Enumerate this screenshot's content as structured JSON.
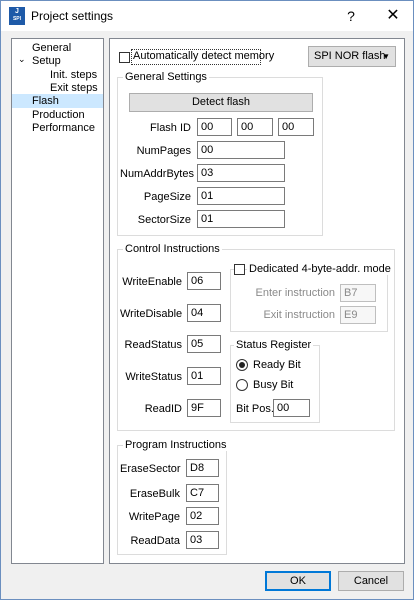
{
  "window": {
    "title": "Project settings",
    "app_icon_text_top": "J",
    "app_icon_text_bottom": "SPI",
    "help_label": "?",
    "close_label": "✕"
  },
  "nav": {
    "items": [
      {
        "label": "General",
        "selected": false
      },
      {
        "label": "Setup",
        "selected": false,
        "expanded": true
      },
      {
        "label": "Init. steps",
        "selected": false
      },
      {
        "label": "Exit steps",
        "selected": false
      },
      {
        "label": "Flash",
        "selected": true
      },
      {
        "label": "Production",
        "selected": false
      },
      {
        "label": "Performance",
        "selected": false
      }
    ],
    "expander_glyph": "⌄"
  },
  "flash": {
    "auto_detect": {
      "label": "Automatically detect memory",
      "checked": false
    },
    "flash_type": {
      "value": "SPI NOR flash",
      "arrow": "▼"
    },
    "general": {
      "title": "General Settings",
      "detect_button": "Detect flash",
      "flash_id": {
        "label": "Flash ID",
        "values": [
          "00",
          "00",
          "00"
        ]
      },
      "num_pages": {
        "label": "NumPages",
        "value": "00"
      },
      "num_addr_bytes": {
        "label": "NumAddrBytes",
        "value": "03"
      },
      "page_size": {
        "label": "PageSize",
        "value": "01"
      },
      "sector_size": {
        "label": "SectorSize",
        "value": "01"
      }
    },
    "control": {
      "title": "Control Instructions",
      "write_enable": {
        "label": "WriteEnable",
        "value": "06"
      },
      "write_disable": {
        "label": "WriteDisable",
        "value": "04"
      },
      "read_status": {
        "label": "ReadStatus",
        "value": "05"
      },
      "write_status": {
        "label": "WriteStatus",
        "value": "01"
      },
      "read_id": {
        "label": "ReadID",
        "value": "9F"
      },
      "dedicated": {
        "label": "Dedicated 4-byte-addr. mode",
        "checked": false,
        "enter_label": "Enter instruction",
        "enter_value": "B7",
        "exit_label": "Exit instruction",
        "exit_value": "E9"
      },
      "status_register": {
        "title": "Status Register",
        "ready_bit": {
          "label": "Ready Bit",
          "selected": true
        },
        "busy_bit": {
          "label": "Busy Bit",
          "selected": false
        },
        "bit_pos": {
          "label": "Bit Pos.",
          "value": "00"
        }
      }
    },
    "program": {
      "title": "Program Instructions",
      "erase_sector": {
        "label": "EraseSector",
        "value": "D8"
      },
      "erase_bulk": {
        "label": "EraseBulk",
        "value": "C7"
      },
      "write_page": {
        "label": "WritePage",
        "value": "02"
      },
      "read_data": {
        "label": "ReadData",
        "value": "03"
      }
    }
  },
  "footer": {
    "ok_label": "OK",
    "cancel_label": "Cancel"
  }
}
